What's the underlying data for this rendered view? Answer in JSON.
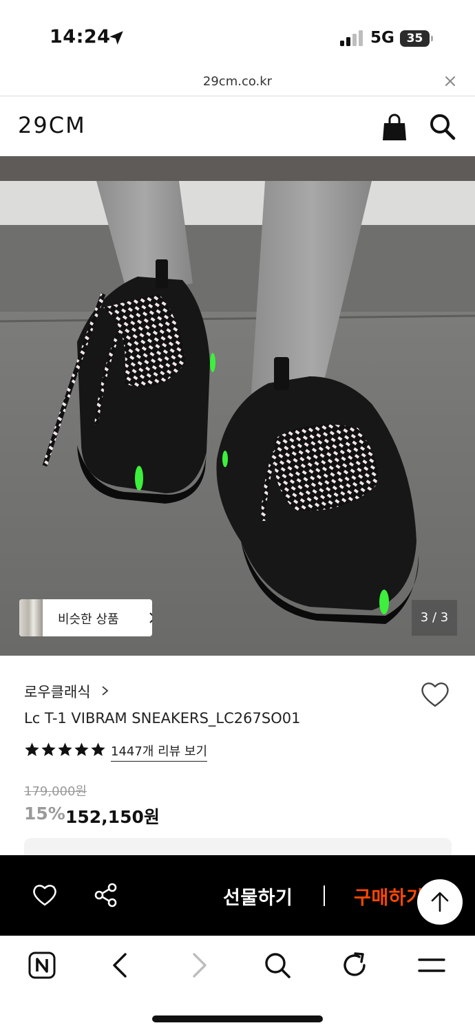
{
  "status_bar": {
    "time": "14:24",
    "network": "5G",
    "battery": "35"
  },
  "url_bar": {
    "url": "29cm.co.kr"
  },
  "header": {
    "logo": "29CM"
  },
  "gallery": {
    "similar_label": "비슷한 상품",
    "page_counter": "3 / 3"
  },
  "product": {
    "brand": "로우클래식",
    "name": "Lc T-1 VIBRAM SNEAKERS_LC267SO01",
    "rating_stars": 5,
    "review_link": "1447개 리뷰 보기",
    "original_price": "179,000원",
    "discount": "15%",
    "sale_price": "152,150원"
  },
  "buy_bar": {
    "gift_label": "선물하기",
    "buy_label": "구매하기"
  },
  "colors": {
    "buy_accent": "#ff4800",
    "neon_green": "#3cf03c"
  }
}
